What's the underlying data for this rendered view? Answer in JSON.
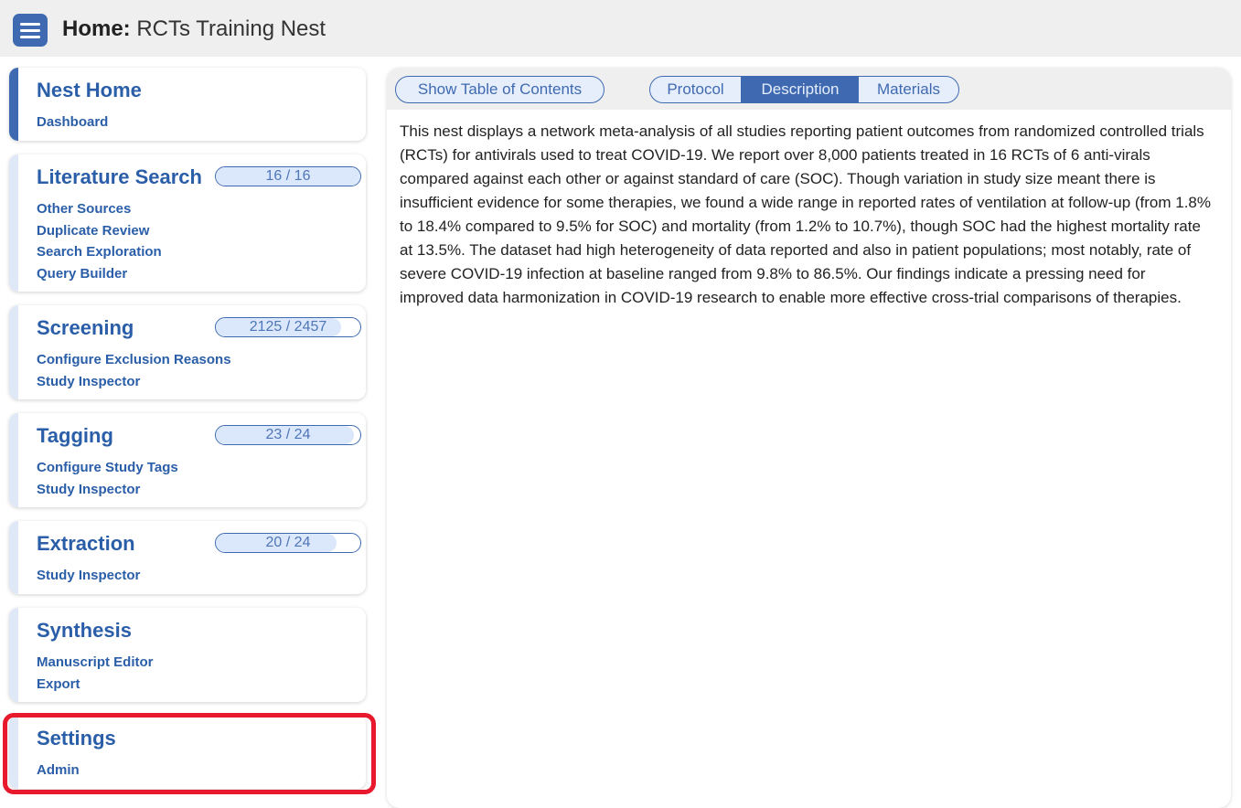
{
  "header": {
    "title_label": "Home:",
    "title_name": "RCTs Training Nest",
    "menu_icon": "hamburger-menu-icon"
  },
  "sidebar": {
    "nest_home": {
      "title": "Nest Home",
      "links": [
        "Dashboard"
      ]
    },
    "literature_search": {
      "title": "Literature Search",
      "progress_text": "16 / 16",
      "progress_fraction": 1.0,
      "links": [
        "Other Sources",
        "Duplicate Review",
        "Search Exploration",
        "Query Builder"
      ]
    },
    "screening": {
      "title": "Screening",
      "progress_text": "2125 / 2457",
      "progress_fraction": 0.865,
      "links": [
        "Configure Exclusion Reasons",
        "Study Inspector"
      ]
    },
    "tagging": {
      "title": "Tagging",
      "progress_text": "23 / 24",
      "progress_fraction": 0.958,
      "links": [
        "Configure Study Tags",
        "Study Inspector"
      ]
    },
    "extraction": {
      "title": "Extraction",
      "progress_text": "20 / 24",
      "progress_fraction": 0.833,
      "links": [
        "Study Inspector"
      ]
    },
    "synthesis": {
      "title": "Synthesis",
      "links": [
        "Manuscript Editor",
        "Export"
      ]
    },
    "settings": {
      "title": "Settings",
      "links": [
        "Admin"
      ]
    }
  },
  "main": {
    "toc_button": "Show Table of Contents",
    "tabs": [
      {
        "label": "Protocol",
        "selected": false
      },
      {
        "label": "Description",
        "selected": true
      },
      {
        "label": "Materials",
        "selected": false
      }
    ],
    "description": "This nest displays a network meta-analysis of all studies reporting patient outcomes from randomized controlled trials (RCTs) for antivirals used to treat COVID-19. We report over 8,000 patients treated in 16 RCTs of 6 anti-virals compared against each other or against standard of care (SOC). Though variation in study size meant there is insufficient evidence for some therapies, we found a wide range in reported rates of ventilation at follow-up (from 1.8% to 18.4% compared to 9.5% for SOC) and mortality (from 1.2% to 10.7%), though SOC had the highest mortality rate at 13.5%. The dataset had high heterogeneity of data reported and also in patient populations; most notably, rate of severe COVID-19 infection at baseline ranged from 9.8% to 86.5%. Our findings indicate a pressing need for improved data harmonization in COVID-19 research to enable more effective cross-trial comparisons of therapies."
  },
  "colors": {
    "accent": "#3f6ab1",
    "link": "#2a5ea8",
    "highlight": "#e8192c",
    "progress_fill": "#dbe7fa"
  }
}
